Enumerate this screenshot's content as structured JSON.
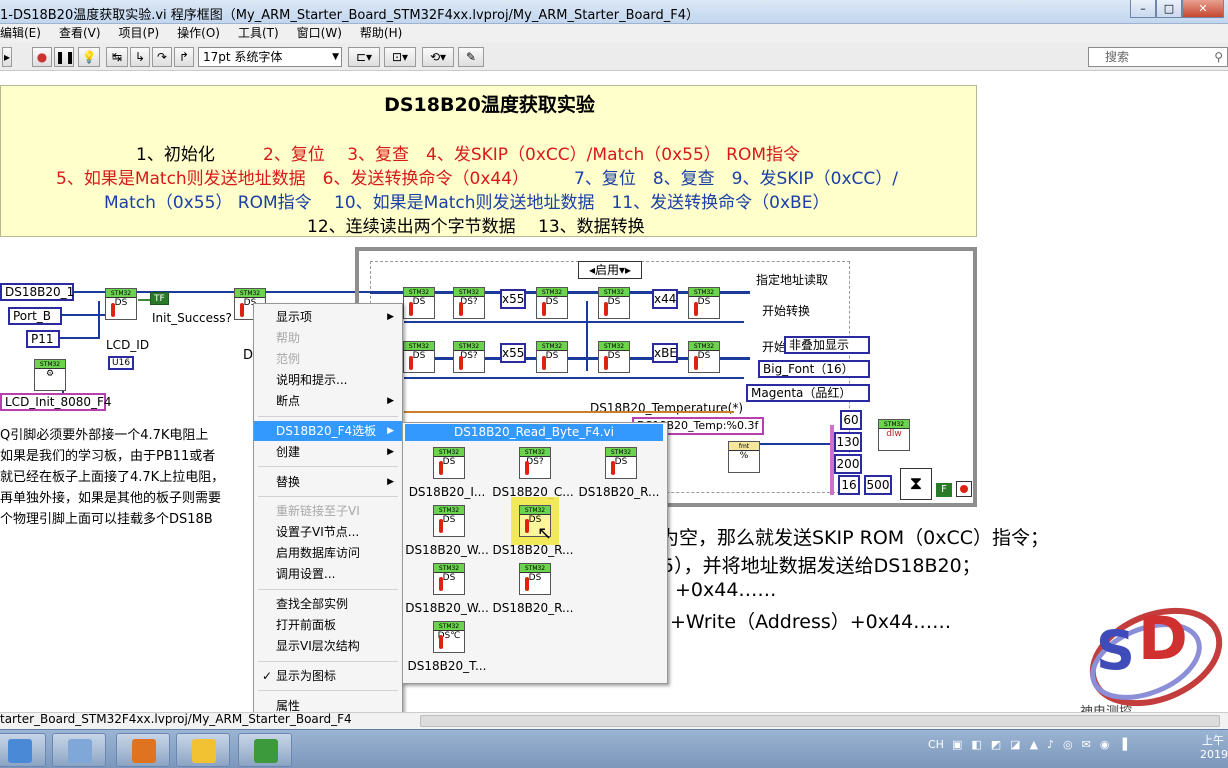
{
  "window": {
    "title": "1-DS18B20温度获取实验.vi 程序框图（My_ARM_Starter_Board_STM32F4xx.lvproj/My_ARM_Starter_Board_F4）",
    "min": "–",
    "max": "□",
    "close": "✕"
  },
  "menubar": [
    "编辑(E)",
    "查看(V)",
    "项目(P)",
    "操作(O)",
    "工具(T)",
    "窗口(W)",
    "帮助(H)"
  ],
  "toolbar": {
    "font": "17pt 系统字体",
    "search_placeholder": "搜索"
  },
  "note": {
    "title": "DS18B20温度获取实验",
    "line1_black": "1、初始化",
    "line1_red": "2、复位　 3、复查　4、发SKIP（0xCC）/Match（0x55） ROM指令",
    "line2_red": "5、如果是Match则发送地址数据　6、发送转换命令（0x44）",
    "line2_blue": "7、复位　8、复查　9、发SKIP（0xCC）/",
    "line3_blue": "Match（0x55） ROM指令　 10、如果是Match则发送地址数据　11、发送转换命令（0xBE）",
    "line4_black": "12、连续读出两个字节数据　 13、数据转换"
  },
  "diagram": {
    "ds_ref": "DS18B20_1",
    "port": "Port_B",
    "pin": "P11",
    "init_success": "Init_Success?",
    "tf": "TF",
    "lcd_id": "LCD_ID",
    "u16": "U16",
    "lcd_init": "LCD_Init_8080_F4",
    "case_sel": "启用",
    "addr_read": "指定地址读取",
    "start_conv": "开始转换",
    "start_read": "开始",
    "overlay": "非叠加显示",
    "font_big": "Big_Font（16）",
    "color": "Magenta（品红）",
    "hex55": "x55",
    "hex44": "x44",
    "hexBE": "xBE",
    "temp_label": "DS18B20_Temperature(*)",
    "temp_fmt": "DS18B20_Temp:%0.3f",
    "n60": "60",
    "n130": "130",
    "n200": "200",
    "n16": "16",
    "n500": "500",
    "d_label": "D",
    "f_label": "F"
  },
  "left_note": [
    "Q引脚必须要外部接一个4.7K电阻上",
    "如果是我们的学习板，由于PB11或者",
    "就已经在板子上面接了4.7K上拉电阻，",
    "再单独外接，如果是其他的板子则需要",
    "个物理引脚上面可以挂载多个DS18B"
  ],
  "right_note": [
    "为空，那么就发送SKIP ROM（0xCC）指令；",
    "5），并将地址数据发送给DS18B20；",
    "+0x44……",
    "+Write（Address）+0x44……"
  ],
  "context_menu": {
    "items": [
      {
        "label": "显示项",
        "sub": true,
        "disabled": false
      },
      {
        "label": "帮助",
        "sub": false,
        "disabled": true
      },
      {
        "label": "范例",
        "sub": false,
        "disabled": true
      },
      {
        "label": "说明和提示...",
        "sub": false,
        "disabled": false
      },
      {
        "label": "断点",
        "sub": true,
        "disabled": false
      },
      {
        "label": "DS18B20_F4选板",
        "sub": true,
        "disabled": false,
        "selected": true
      },
      {
        "label": "创建",
        "sub": true,
        "disabled": false
      },
      {
        "label": "替换",
        "sub": true,
        "disabled": false
      },
      {
        "label": "重新链接至子VI",
        "sub": false,
        "disabled": true
      },
      {
        "label": "设置子VI节点...",
        "sub": false,
        "disabled": false
      },
      {
        "label": "启用数据库访问",
        "sub": false,
        "disabled": false
      },
      {
        "label": "调用设置...",
        "sub": false,
        "disabled": false
      },
      {
        "label": "查找全部实例",
        "sub": false,
        "disabled": false
      },
      {
        "label": "打开前面板",
        "sub": false,
        "disabled": false
      },
      {
        "label": "显示VI层次结构",
        "sub": false,
        "disabled": false
      },
      {
        "label": "显示为图标",
        "sub": false,
        "disabled": false,
        "checked": true
      },
      {
        "label": "属性",
        "sub": false,
        "disabled": false
      }
    ]
  },
  "palette": {
    "header": "DS18B20_Read_Byte_F4.vi",
    "items": [
      "DS18B20_I...",
      "DS18B20_C...",
      "DS18B20_R...",
      "DS18B20_W...",
      "DS18B20_R...",
      "DS18B20_W...",
      "DS18B20_R...",
      "DS18B20_T..."
    ]
  },
  "statusbar": "tarter_Board_STM32F4xx.lvproj/My_ARM_Starter_Board_F4",
  "watermark": "神电测控",
  "taskbar": {
    "tray_lang": "CH",
    "clock_top": "上午",
    "clock_bottom": "2019"
  },
  "colors": {
    "note_bg": "#ffffcc",
    "wire_blue": "#1a3a9c",
    "menu_highlight": "#3399ff",
    "vi_green": "#6bd34e"
  }
}
